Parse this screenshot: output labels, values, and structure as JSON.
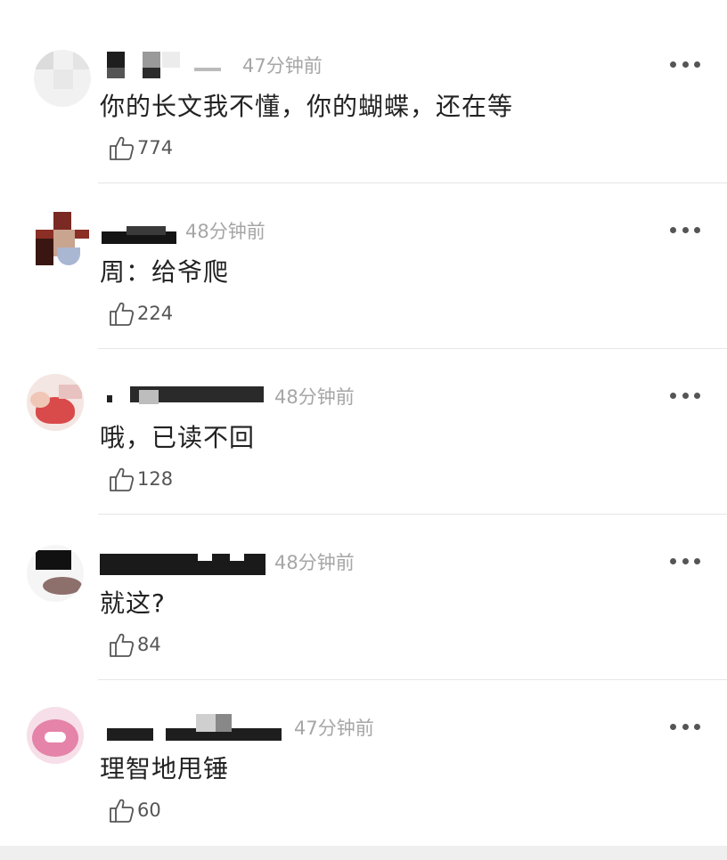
{
  "comments": [
    {
      "time": "47分钟前",
      "text": "你的长文我不懂，你的蝴蝶，还在等",
      "likes": "774",
      "like_icon": "thumbs-up-icon",
      "more_icon": "more-dots-icon"
    },
    {
      "time": "48分钟前",
      "text": "周：给爷爬",
      "likes": "224",
      "like_icon": "thumbs-up-icon",
      "more_icon": "more-dots-icon"
    },
    {
      "time": "48分钟前",
      "text": "哦，已读不回",
      "likes": "128",
      "like_icon": "thumbs-up-icon",
      "more_icon": "more-dots-icon"
    },
    {
      "time": "48分钟前",
      "text": "就这?",
      "likes": "84",
      "like_icon": "thumbs-up-icon",
      "more_icon": "more-dots-icon"
    },
    {
      "time": "47分钟前",
      "text": "理智地甩锤",
      "likes": "60",
      "like_icon": "thumbs-up-icon",
      "more_icon": "more-dots-icon"
    }
  ]
}
